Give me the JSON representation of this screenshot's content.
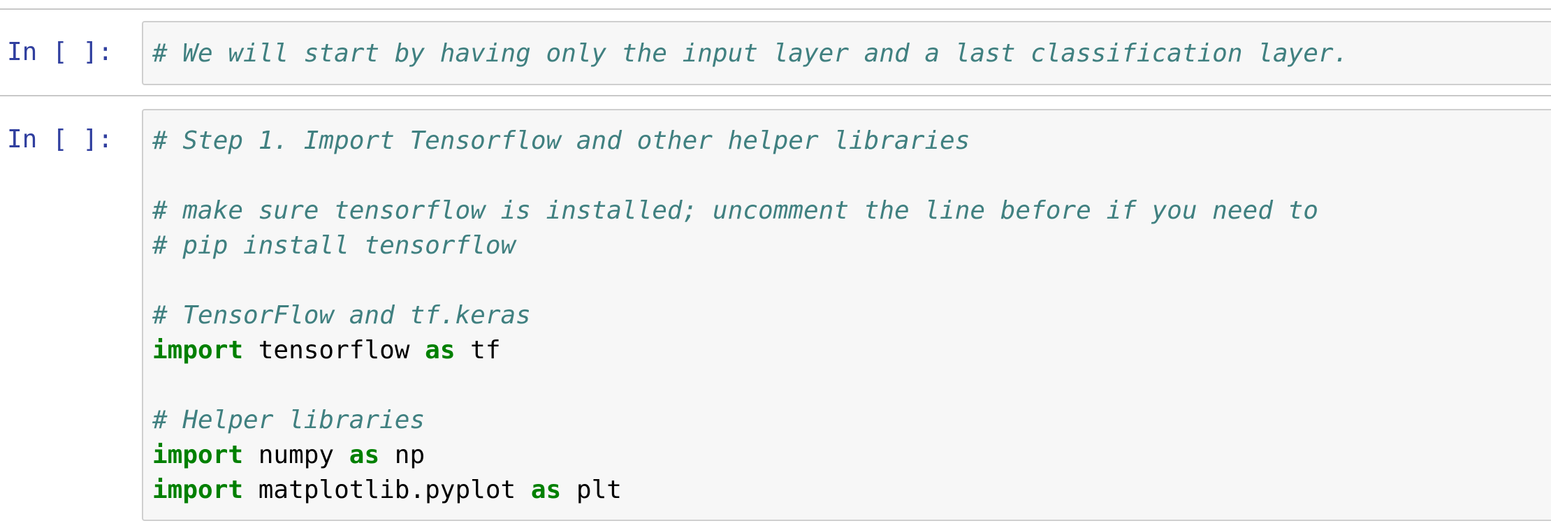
{
  "notebook": {
    "cells": [
      {
        "prompt": "In [ ]:",
        "lines": [
          [
            {
              "type": "comment",
              "text": "# We will start by having only the input layer and a last classification layer."
            }
          ]
        ]
      },
      {
        "prompt": "In [ ]:",
        "lines": [
          [
            {
              "type": "comment",
              "text": "# Step 1. Import Tensorflow and other helper libraries"
            }
          ],
          [],
          [
            {
              "type": "comment",
              "text": "# make sure tensorflow is installed; uncomment the line before if you need to"
            }
          ],
          [
            {
              "type": "comment",
              "text": "# pip install tensorflow"
            }
          ],
          [],
          [
            {
              "type": "comment",
              "text": "# TensorFlow and tf.keras"
            }
          ],
          [
            {
              "type": "keyword",
              "text": "import"
            },
            {
              "type": "name",
              "text": " tensorflow "
            },
            {
              "type": "keyword",
              "text": "as"
            },
            {
              "type": "name",
              "text": " tf"
            }
          ],
          [],
          [
            {
              "type": "comment",
              "text": "# Helper libraries"
            }
          ],
          [
            {
              "type": "keyword",
              "text": "import"
            },
            {
              "type": "name",
              "text": " numpy "
            },
            {
              "type": "keyword",
              "text": "as"
            },
            {
              "type": "name",
              "text": " np"
            }
          ],
          [
            {
              "type": "keyword",
              "text": "import"
            },
            {
              "type": "name",
              "text": " matplotlib.pyplot "
            },
            {
              "type": "keyword",
              "text": "as"
            },
            {
              "type": "name",
              "text": " plt"
            }
          ]
        ]
      }
    ],
    "colors": {
      "prompt": "#303f9f",
      "comment": "#408080",
      "keyword": "#008000",
      "code_background": "#f7f7f7",
      "border": "#cfcfcf"
    }
  }
}
